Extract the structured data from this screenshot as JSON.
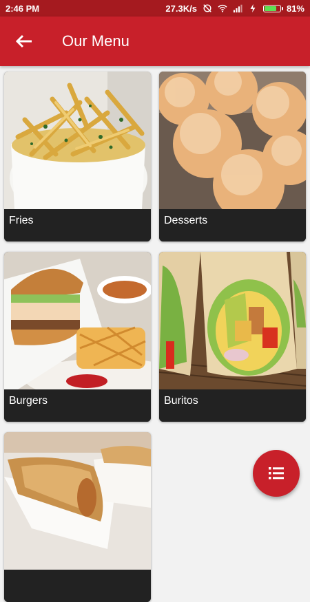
{
  "status_bar": {
    "time": "2:46 PM",
    "network_speed": "27.3K/s",
    "battery": "81%",
    "battery_level": 0.81,
    "icons": [
      "mute-icon",
      "wifi-icon",
      "signal-icon",
      "charging-icon",
      "battery-icon"
    ]
  },
  "app_bar": {
    "title": "Our Menu",
    "back_icon": "arrow-left-icon"
  },
  "menu_items": [
    {
      "label": "Fries"
    },
    {
      "label": "Desserts"
    },
    {
      "label": "Burgers"
    },
    {
      "label": "Buritos"
    },
    {
      "label": ""
    }
  ],
  "fab": {
    "icon": "list-icon"
  },
  "colors": {
    "primary": "#c8202a",
    "status_bar": "#a51a1f",
    "card_label_bg": "#222222"
  }
}
